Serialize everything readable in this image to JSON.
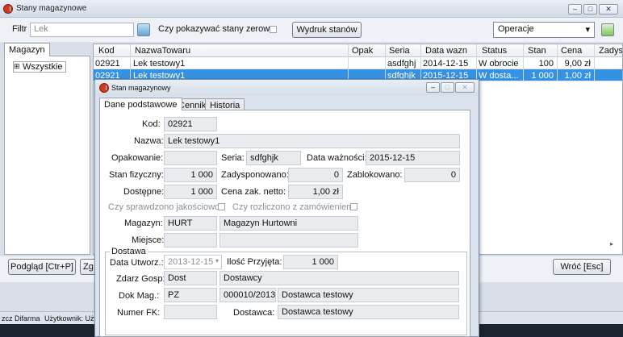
{
  "window": {
    "title": "Stany magazynowe",
    "minimize": "–",
    "restore": "□",
    "close": "✕"
  },
  "toolbar": {
    "filter_label": "Filtr",
    "filter_value": "Lek",
    "show_zero_label": "Czy pokazywać stany zerowe",
    "print_button": "Wydruk stanów",
    "operations_value": "Operacje",
    "operations_arrow": "▾"
  },
  "left_pane": {
    "tab_label": "Magazyn",
    "tree": [
      {
        "expander": "⊞",
        "label": "Wszystkie"
      }
    ],
    "scroll_arrow": "▸"
  },
  "grid": {
    "columns": [
      "Kod",
      "NazwaTowaru",
      "Opak",
      "Seria",
      "Data wazn",
      "Status",
      "Stan",
      "Cena",
      "Zadys"
    ],
    "rows": [
      {
        "kod": "02921",
        "nazwa": "Lek testowy1",
        "opak": "",
        "seria": "asdfghj",
        "data": "2014-12-15",
        "status": "W obrocie",
        "stan": "100",
        "cena": "9,00 zł",
        "zadys": ""
      },
      {
        "kod": "02921",
        "nazwa": "Lek testowy1",
        "opak": "",
        "seria": "sdfghjk",
        "data": "2015-12-15",
        "status": "W dosta...",
        "stan": "1 000",
        "cena": "1,00 zł",
        "zadys": ""
      }
    ],
    "selected_row": 1
  },
  "bottom": {
    "preview_button": "Podgląd [Ctr+P]",
    "partial_button": "Zg",
    "back_button": "Wróć [Esc]"
  },
  "statusbar": {
    "company": "zcz Difarma",
    "user": "Użytkownik: Użytk"
  },
  "dialog": {
    "title": "Stan magazynowy",
    "tabs": [
      "Dane podstawowe",
      "Cennik",
      "Historia"
    ],
    "active_tab": 0,
    "fields": {
      "kod_label": "Kod:",
      "kod": "02921",
      "nazwa_label": "Nazwa:",
      "nazwa": "Lek testowy1",
      "opak_label": "Opakowanie:",
      "opak": "",
      "seria_label": "Seria:",
      "seria": "sdfghjk",
      "data_waz_label": "Data ważności:",
      "data_waz": "2015-12-15",
      "stan_fiz_label": "Stan fizyczny:",
      "stan_fiz": "1 000",
      "zadysp_label": "Zadysponowano:",
      "zadysp": "0",
      "zablok_label": "Zablokowano:",
      "zablok": "0",
      "dostepne_label": "Dostępne:",
      "dostepne": "1 000",
      "cena_zak_label": "Cena zak. netto:",
      "cena_zak": "1,00 zł",
      "jakosc_label": "Czy sprawdzono jakościowo",
      "rozliczono_label": "Czy rozliczono z zamówieniem",
      "magazyn_label": "Magazyn:",
      "magazyn_kod": "HURT",
      "magazyn_nazwa": "Magazyn Hurtowni",
      "miejsce_label": "Miejsce:",
      "miejsce1": "",
      "miejsce2": ""
    },
    "dostawa": {
      "group_label": "Dostawa",
      "data_utw_label": "Data Utworz.:",
      "data_utw": "2013-12-15",
      "ilosc_label": "Ilość Przyjęta:",
      "ilosc": "1 000",
      "zdarz_label": "Zdarz Gosp:",
      "zdarz_kod": "Dost",
      "zdarz_nazwa": "Dostawcy",
      "dokmag_label": "Dok Mag.:",
      "dokmag_typ": "PZ",
      "dokmag_nr": "000010/2013",
      "dokmag_dost": "Dostawca testowy",
      "numerfk_label": "Numer FK:",
      "numerfk": "",
      "dostawca_label": "Dostawca:",
      "dostawca": "Dostawca testowy"
    }
  }
}
